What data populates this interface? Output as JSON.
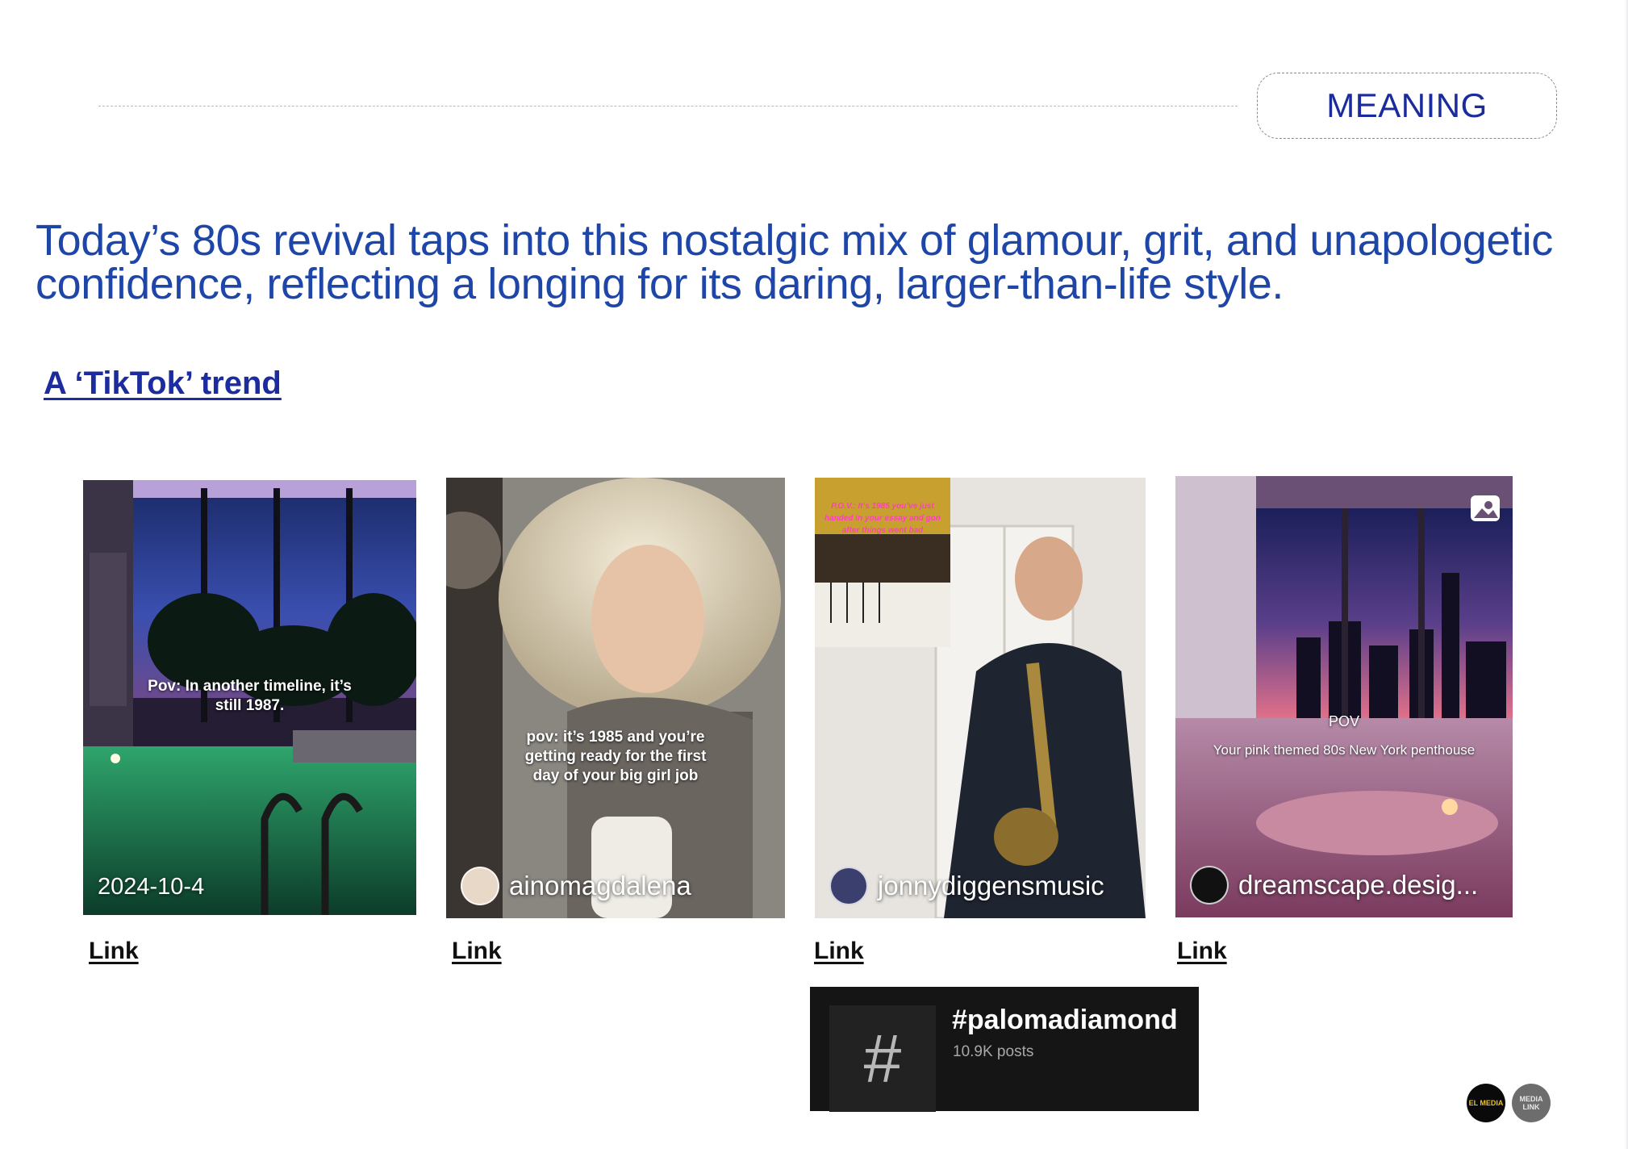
{
  "section_label": "MEANING",
  "headline": "Today’s 80s revival taps into this nostalgic mix of glamour, grit, and unapologetic confidence, reflecting a longing for its daring, larger-than-life style.",
  "subheading": "A ‘TikTok’ trend",
  "videos": [
    {
      "caption": "Pov: In another timeline, it’s still 1987.",
      "footer": "2024-10-4",
      "link_label": "Link"
    },
    {
      "caption": "pov: it’s 1985 and you’re getting ready for the first day of your big girl job",
      "footer": "ainomagdalena",
      "link_label": "Link"
    },
    {
      "overlay": "P.O.V.: It’s 1985 you’ve just handed in your essay and gon after things went bad",
      "footer": "jonnydiggensmusic",
      "link_label": "Link"
    },
    {
      "caption_title": "POV",
      "caption": "Your pink themed 80s New York penthouse",
      "footer": "dreamscape.desig...",
      "link_label": "Link"
    }
  ],
  "hashtag": {
    "tag": "#palomadiamond",
    "posts": "10.9K posts",
    "icon": "#"
  },
  "logos": [
    {
      "text": "EL MEDIA"
    },
    {
      "text": "MEDIA LINK"
    }
  ]
}
